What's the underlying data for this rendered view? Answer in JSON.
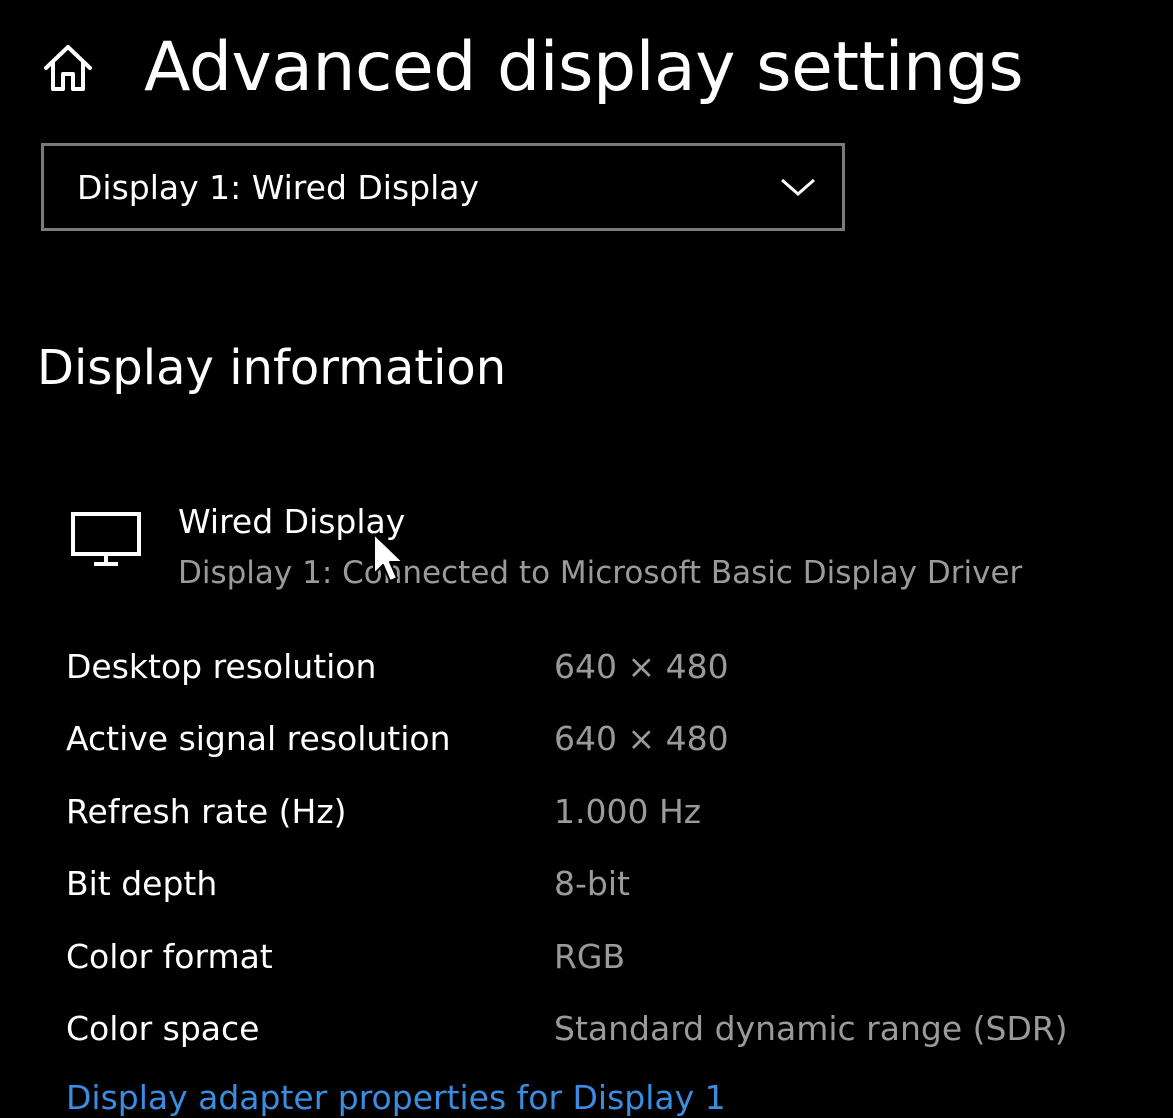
{
  "header": {
    "title": "Advanced display settings",
    "home_icon": "home-icon"
  },
  "display_select": {
    "selected": "Display 1: Wired Display",
    "icon": "chevron-down-icon"
  },
  "display_info": {
    "section_title": "Display information",
    "monitor": {
      "icon": "monitor-icon",
      "name": "Wired Display",
      "description": "Display 1: Connected to Microsoft Basic Display Driver"
    },
    "rows": [
      {
        "label": "Desktop resolution",
        "value": "640 × 480"
      },
      {
        "label": "Active signal resolution",
        "value": "640 × 480"
      },
      {
        "label": "Refresh rate (Hz)",
        "value": "1.000 Hz"
      },
      {
        "label": "Bit depth",
        "value": "8-bit"
      },
      {
        "label": "Color format",
        "value": "RGB"
      },
      {
        "label": "Color space",
        "value": "Standard dynamic range (SDR)"
      }
    ],
    "adapter_link": "Display adapter properties for Display 1"
  },
  "colors": {
    "background": "#000000",
    "text": "#ffffff",
    "secondary_text": "#9a9a9a",
    "link": "#3a8de0",
    "border": "#7a7a7a"
  }
}
